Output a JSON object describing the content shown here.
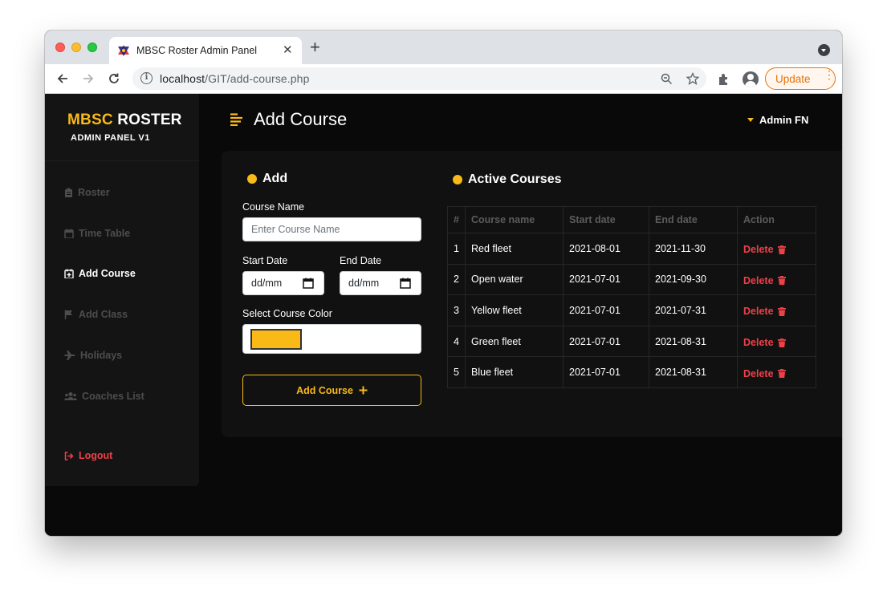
{
  "browser": {
    "tab_title": "MBSC Roster Admin Panel",
    "url_host": "localhost",
    "url_path": "/GIT/add-course.php",
    "update_label": "Update"
  },
  "sidebar": {
    "brand_accent": "MBSC",
    "brand_main": "ROSTER",
    "subtitle": "ADMIN PANEL V1",
    "items": [
      {
        "label": "Roster",
        "icon": "clipboard-icon"
      },
      {
        "label": "Time Table",
        "icon": "calendar-icon"
      },
      {
        "label": "Add Course",
        "icon": "calendar-plus-icon"
      },
      {
        "label": "Add Class",
        "icon": "flag-icon"
      },
      {
        "label": "Holidays",
        "icon": "plane-icon"
      },
      {
        "label": "Coaches List",
        "icon": "users-icon"
      }
    ],
    "logout": "Logout"
  },
  "header": {
    "title": "Add Course",
    "user": "Admin FN"
  },
  "form": {
    "heading": "Add",
    "course_name_label": "Course Name",
    "course_name_placeholder": "Enter Course Name",
    "start_date_label": "Start Date",
    "end_date_label": "End Date",
    "date_placeholder": "dd/mm",
    "color_label": "Select Course Color",
    "color_value": "#f9b917",
    "submit_label": "Add Course"
  },
  "courses": {
    "heading": "Active Courses",
    "columns": [
      "#",
      "Course name",
      "Start date",
      "End date",
      "Action"
    ],
    "rows": [
      {
        "num": "1",
        "name": "Red fleet",
        "start": "2021-08-01",
        "end": "2021-11-30",
        "action": "Delete"
      },
      {
        "num": "2",
        "name": "Open water",
        "start": "2021-07-01",
        "end": "2021-09-30",
        "action": "Delete"
      },
      {
        "num": "3",
        "name": "Yellow fleet",
        "start": "2021-07-01",
        "end": "2021-07-31",
        "action": "Delete"
      },
      {
        "num": "4",
        "name": "Green fleet",
        "start": "2021-07-01",
        "end": "2021-08-31",
        "action": "Delete"
      },
      {
        "num": "5",
        "name": "Blue fleet",
        "start": "2021-07-01",
        "end": "2021-08-31",
        "action": "Delete"
      }
    ]
  },
  "colors": {
    "accent": "#f9b917",
    "danger": "#ee4048",
    "background": "#090909"
  }
}
